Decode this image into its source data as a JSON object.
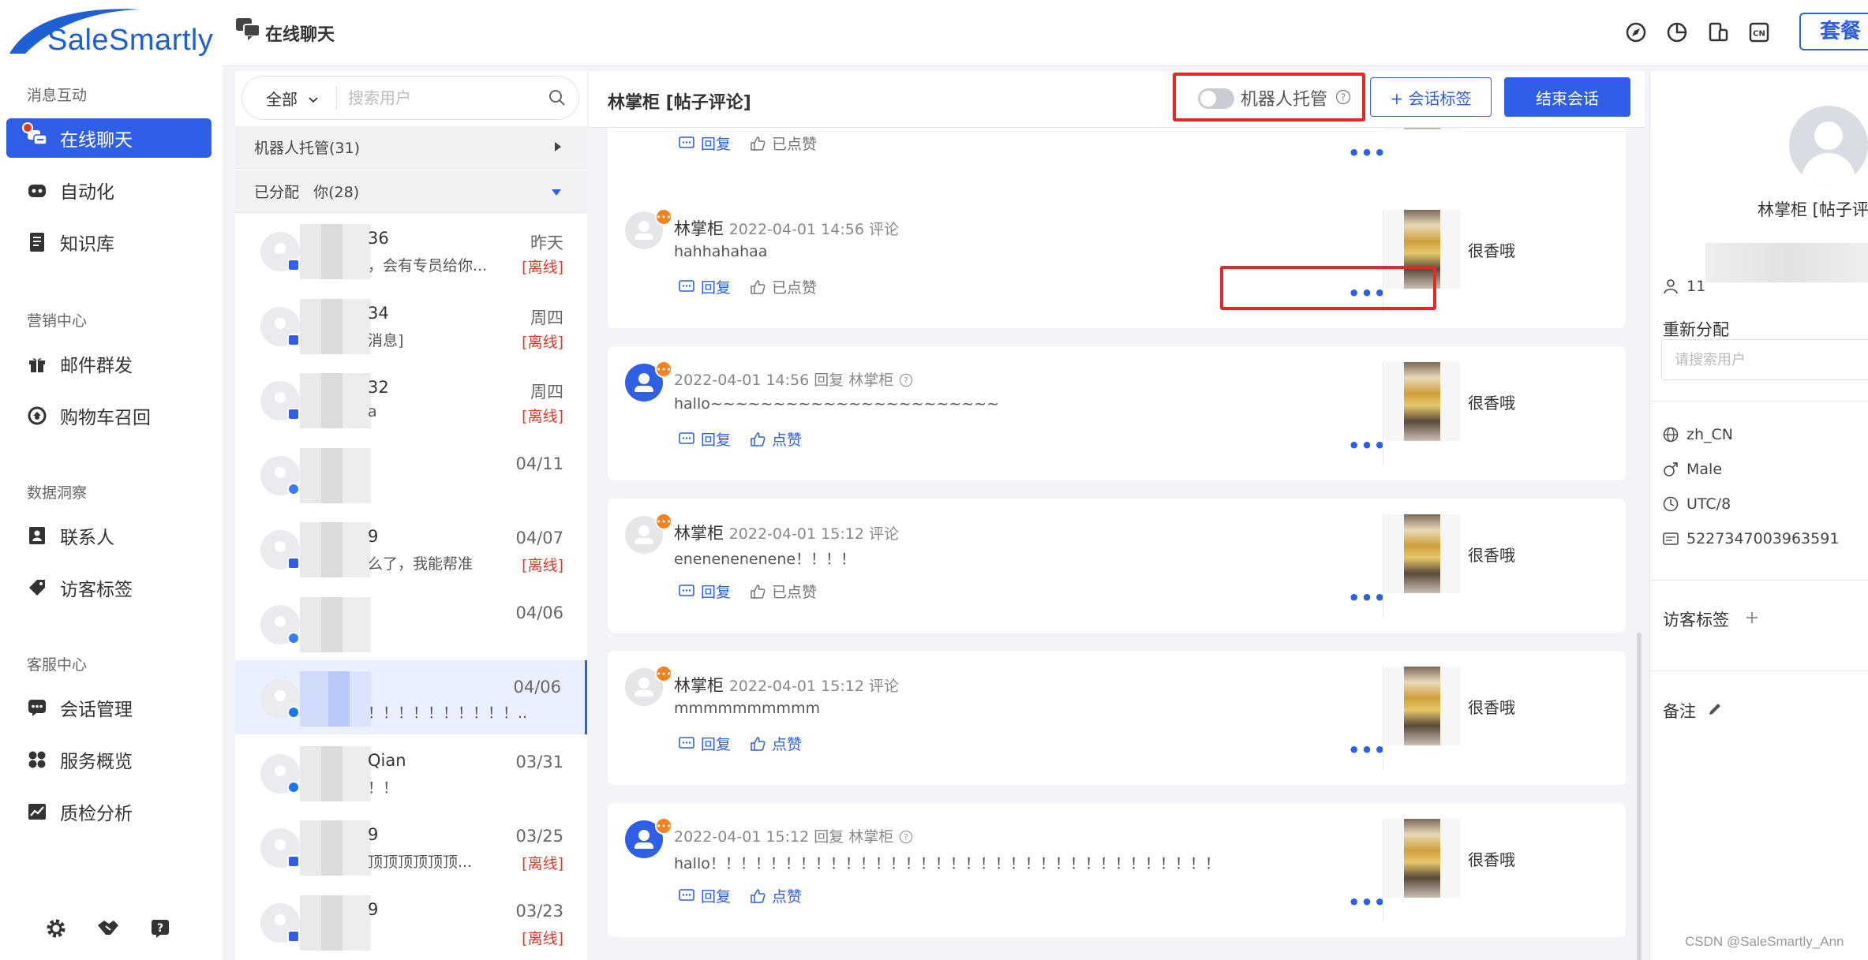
{
  "brand": {
    "logo_text": "SaleSmartly",
    "color": "#2e5fe6"
  },
  "nav": {
    "sections": [
      {
        "title": "消息互动",
        "items": [
          {
            "label": "在线聊天",
            "icon": "chat-icon",
            "active": true
          },
          {
            "label": "自动化",
            "icon": "robot-icon"
          },
          {
            "label": "知识库",
            "icon": "book-icon"
          }
        ]
      },
      {
        "title": "营销中心",
        "items": [
          {
            "label": "邮件群发",
            "icon": "gift-icon"
          },
          {
            "label": "购物车召回",
            "icon": "cart-recall-icon"
          }
        ]
      },
      {
        "title": "数据洞察",
        "items": [
          {
            "label": "联系人",
            "icon": "contact-icon"
          },
          {
            "label": "访客标签",
            "icon": "tag-icon"
          }
        ]
      },
      {
        "title": "客服中心",
        "items": [
          {
            "label": "会话管理",
            "icon": "session-icon"
          },
          {
            "label": "服务概览",
            "icon": "overview-icon"
          },
          {
            "label": "质检分析",
            "icon": "analysis-icon"
          }
        ]
      }
    ]
  },
  "header": {
    "title": "在线聊天",
    "cn_badge": "CN",
    "plan_label": "套餐"
  },
  "conversations": {
    "filter_label": "全部",
    "search_placeholder": "搜索用户",
    "groups": [
      {
        "label": "机器人托管(31)"
      },
      {
        "label": "已分配   你(28)"
      }
    ],
    "items": [
      {
        "name": "36",
        "msg": "，会有专员给你...",
        "time": "昨天",
        "status": "[离线]",
        "channel": "chat"
      },
      {
        "name": "34",
        "msg": "消息]",
        "time": "周四",
        "status": "[离线]",
        "channel": "chat"
      },
      {
        "name": "32",
        "msg": "a",
        "time": "周四",
        "status": "[离线]",
        "channel": "chat"
      },
      {
        "name": "",
        "msg": "",
        "time": "04/11",
        "status": "",
        "channel": "messenger"
      },
      {
        "name": "9",
        "msg": "么了，我能帮准",
        "time": "04/07",
        "status": "[离线]",
        "channel": "chat"
      },
      {
        "name": "",
        "msg": "",
        "time": "04/06",
        "status": "",
        "channel": "messenger"
      },
      {
        "name": "",
        "msg": "！！！！！！！！！！...",
        "time": "04/06",
        "status": "",
        "channel": "facebook",
        "selected": true
      },
      {
        "name": "Qian",
        "msg": "！！",
        "time": "03/31",
        "status": "",
        "channel": "facebook"
      },
      {
        "name": "9",
        "msg": "顶顶顶顶顶顶...",
        "time": "03/25",
        "status": "[离线]",
        "channel": "chat"
      },
      {
        "name": "9",
        "msg": "",
        "time": "03/23",
        "status": "[离线]",
        "channel": "chat"
      }
    ]
  },
  "chat": {
    "title": "林掌柜 [帖子评论]",
    "bot_label": "机器人托管",
    "tag_button": "+ 会话标签",
    "end_button": "结束会话",
    "reply_label": "回复",
    "liked_label": "已点赞",
    "like_label": "点赞",
    "more": "•••",
    "post_text": "很香哦",
    "cards": [
      {
        "type": "comment",
        "name": "林掌柜",
        "meta": "2022-04-01 14:56 评论",
        "text": "hahhahahaa",
        "liked": true
      },
      {
        "type": "reply",
        "meta_prefix": "2022-04-01 14:56 回复 ",
        "reply_to": "林掌柜",
        "text": "hallo~~~~~~~~~~~~~~~~~~~~~~~",
        "liked": false
      },
      {
        "type": "comment",
        "name": "林掌柜",
        "meta": "2022-04-01 15:12 评论",
        "text": "enenenenenene！！！！",
        "liked": true
      },
      {
        "type": "comment",
        "name": "林掌柜",
        "meta": "2022-04-01 15:12 评论",
        "text": "mmmmmmmmmm",
        "liked": false
      },
      {
        "type": "reply",
        "meta_prefix": "2022-04-01 15:12 回复 ",
        "reply_to": "林掌柜",
        "text": "hallo！！！！！！！！！！！！！！！！！！！！！！！！！！！！！！！！！！",
        "liked": false
      }
    ]
  },
  "info": {
    "name": "林掌柜 [帖子评",
    "id_prefix": "11",
    "reassign_label": "重新分配",
    "reassign_placeholder": "请搜索用户",
    "language": "zh_CN",
    "gender": "Male",
    "timezone": "UTC/8",
    "uid": "5227347003963591",
    "visitor_tags_label": "访客标签",
    "notes_label": "备注"
  },
  "watermark": "CSDN @SaleSmartly_Ann"
}
